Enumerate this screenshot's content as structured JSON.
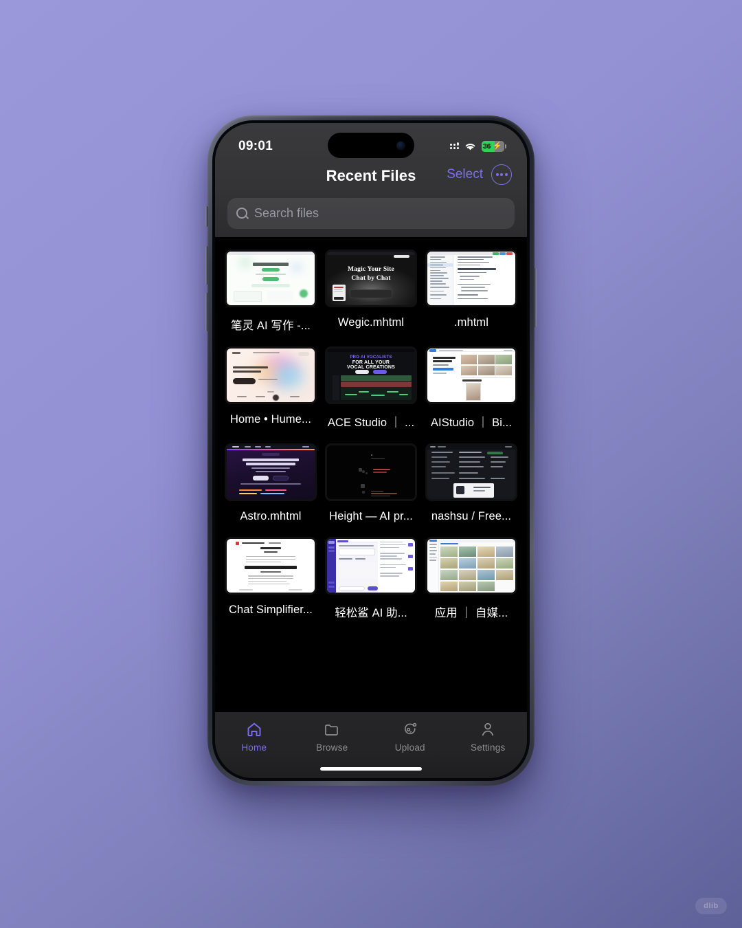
{
  "status_bar": {
    "time": "09:01",
    "cellular_icon": "cellular-signal-icon",
    "wifi_icon": "wifi-icon",
    "battery_percent": "36",
    "battery_charging_icon": "lightning-bolt-icon"
  },
  "nav": {
    "title": "Recent Files",
    "select_label": "Select",
    "more_icon": "ellipsis-circle-icon"
  },
  "search": {
    "placeholder": "Search files",
    "icon": "search-icon"
  },
  "files": [
    {
      "name": "笔灵 AI 写作 -...",
      "thumb": "t-bili"
    },
    {
      "name": "Wegic.mhtml",
      "thumb": "t-wegic",
      "hero_line1": "Magic Your Site",
      "hero_line2": "Chat by Chat"
    },
    {
      "name": ".mhtml",
      "thumb": "t-code"
    },
    {
      "name": "Home • Hume...",
      "thumb": "t-hume"
    },
    {
      "name": "ACE Studio ｜ ...",
      "thumb": "t-ace",
      "hero_line1": "PRO AI VOCALISTS",
      "hero_line2": "FOR ALL YOUR",
      "hero_line3": "VOCAL CREATIONS"
    },
    {
      "name": "AIStudio ｜ Bi...",
      "thumb": "t-aistudio"
    },
    {
      "name": "Astro.mhtml",
      "thumb": "t-astro"
    },
    {
      "name": "Height — AI pr...",
      "thumb": "t-height"
    },
    {
      "name": "nashsu / Free...",
      "thumb": "t-nashsu"
    },
    {
      "name": "Chat Simplifier...",
      "thumb": "t-chat"
    },
    {
      "name": "轻松鲨 AI 助...",
      "thumb": "t-shark"
    },
    {
      "name": "应用 ｜ 自媒...",
      "thumb": "t-apps"
    }
  ],
  "tabbar": [
    {
      "label": "Home",
      "icon": "home-icon",
      "active": true
    },
    {
      "label": "Browse",
      "icon": "folder-icon",
      "active": false
    },
    {
      "label": "Upload",
      "icon": "upload-orbit-icon",
      "active": false
    },
    {
      "label": "Settings",
      "icon": "person-icon",
      "active": false
    }
  ],
  "watermark": {
    "text": "dlib"
  },
  "colors": {
    "accent": "#7c6ef0",
    "background_start": "#9a98da",
    "background_end": "#5e6098",
    "battery_green": "#30d158",
    "screen_black": "#000000"
  }
}
